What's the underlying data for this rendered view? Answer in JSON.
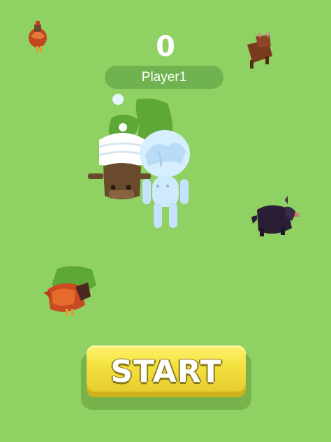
{
  "hud": {
    "score": "0",
    "player_name": "Player1"
  },
  "start_button": {
    "label": "START"
  },
  "colors": {
    "ground": "#8fd162",
    "shadow": "#5ea838",
    "player": "#cfe9ff",
    "start_yellow": "#f3e03e"
  },
  "scene": {
    "creatures": [
      "hen-icon",
      "boar-icon",
      "bull-icon",
      "sheep-icon",
      "rooster-icon",
      "player-character"
    ]
  }
}
